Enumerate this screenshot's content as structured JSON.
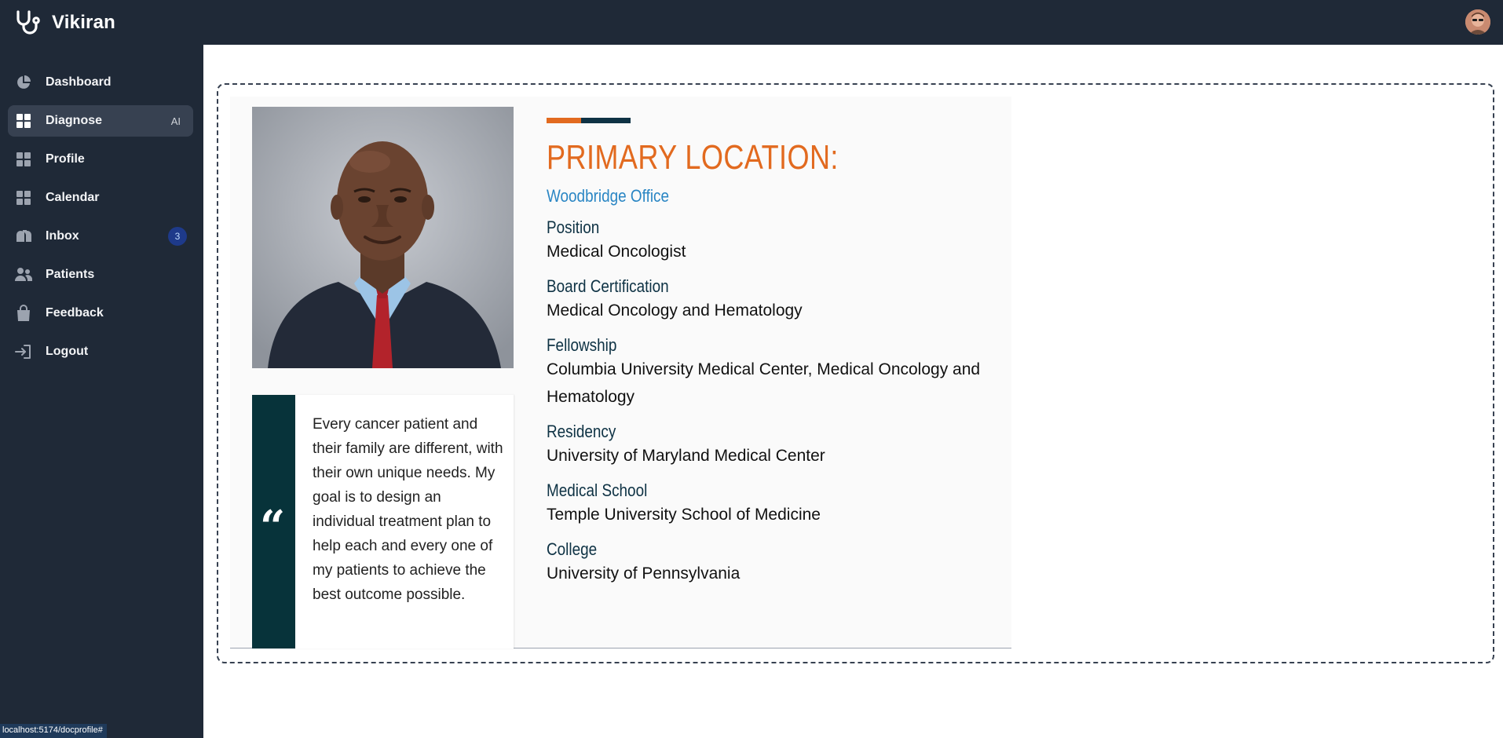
{
  "app": {
    "name": "Vikiran"
  },
  "sidebar": {
    "items": [
      {
        "label": "Dashboard",
        "icon": "pie-chart-icon"
      },
      {
        "label": "Diagnose",
        "icon": "grid-icon",
        "tag": "AI",
        "active": true
      },
      {
        "label": "Profile",
        "icon": "grid-icon"
      },
      {
        "label": "Calendar",
        "icon": "grid-icon"
      },
      {
        "label": "Inbox",
        "icon": "mailbox-icon",
        "badge": "3"
      },
      {
        "label": "Patients",
        "icon": "users-icon"
      },
      {
        "label": "Feedback",
        "icon": "shopping-bag-icon"
      },
      {
        "label": "Logout",
        "icon": "logout-icon"
      }
    ]
  },
  "status_url": "localhost:5174/docprofile#",
  "profile": {
    "quote": "Every cancer patient and their family are different, with their own unique needs. My goal is to design an individual treatment plan to help each and every one of my patients to achieve the best outcome possible.",
    "heading": "PRIMARY LOCATION:",
    "office": "Woodbridge Office",
    "fields": [
      {
        "label": "Position",
        "value": "Medical Oncologist"
      },
      {
        "label": "Board Certification",
        "value": "Medical Oncology and Hematology"
      },
      {
        "label": "Fellowship",
        "value": "Columbia University Medical Center, Medical Oncology and Hematology"
      },
      {
        "label": "Residency",
        "value": "University of Maryland Medical Center"
      },
      {
        "label": "Medical School",
        "value": "Temple University School of Medicine"
      },
      {
        "label": "College",
        "value": "University of Pennsylvania"
      }
    ]
  },
  "colors": {
    "sidebar_bg": "#1f2937",
    "accent_orange": "#e26a1f",
    "accent_navy": "#0e3244",
    "office_blue": "#2a86c4",
    "quote_bar": "#07333a"
  }
}
